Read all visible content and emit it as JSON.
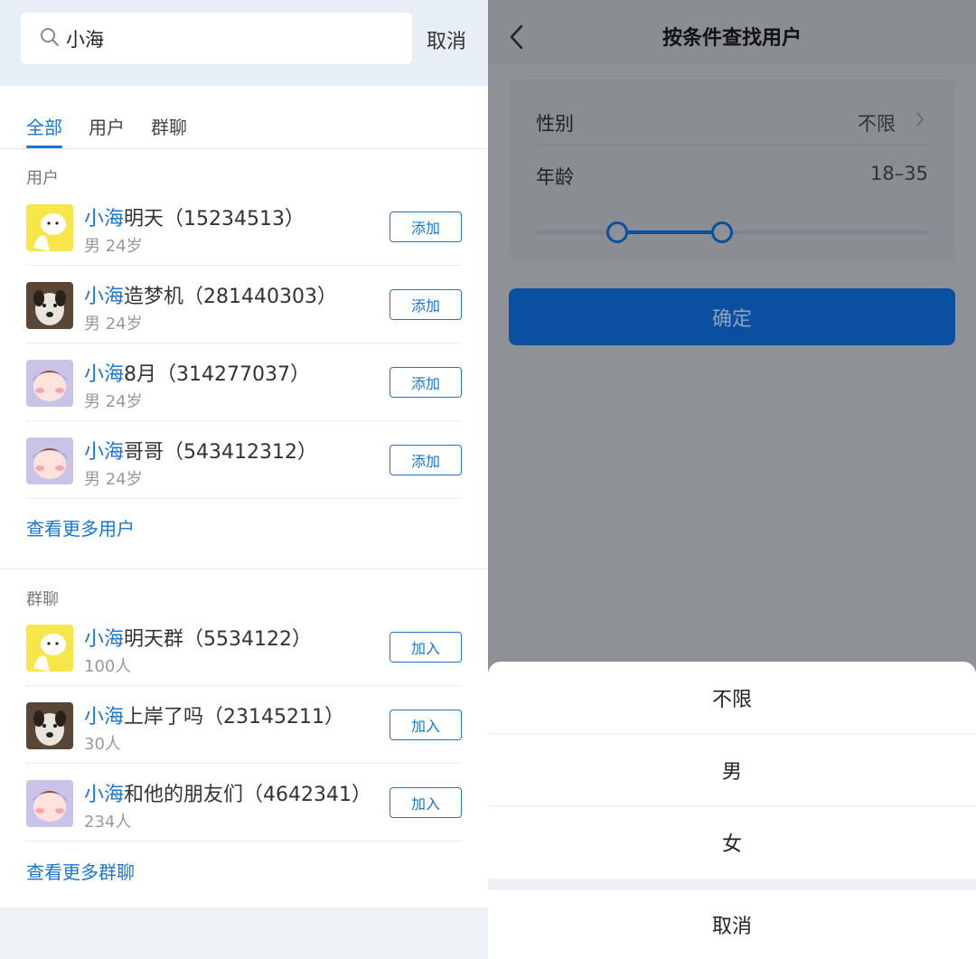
{
  "search": {
    "query": "小海",
    "cancel_label": "取消"
  },
  "tabs": [
    {
      "label": "全部",
      "active": true
    },
    {
      "label": "用户",
      "active": false
    },
    {
      "label": "群聊",
      "active": false
    }
  ],
  "users_section": {
    "label": "用户",
    "items": [
      {
        "highlight": "小海",
        "rest": "明天（15234513）",
        "sub": "男 24岁",
        "action": "添加",
        "avatar": "cartoon-yellow-avatar"
      },
      {
        "highlight": "小海",
        "rest": "造梦机（281440303）",
        "sub": "男 24岁",
        "action": "添加",
        "avatar": "dog-photo-avatar"
      },
      {
        "highlight": "小海",
        "rest": "8月（314277037）",
        "sub": "男 24岁",
        "action": "添加",
        "avatar": "cartoon-girl-avatar"
      },
      {
        "highlight": "小海",
        "rest": "哥哥（543412312）",
        "sub": "男 24岁",
        "action": "添加",
        "avatar": "cartoon-girl-avatar"
      }
    ],
    "more_label": "查看更多用户"
  },
  "groups_section": {
    "label": "群聊",
    "items": [
      {
        "highlight": "小海",
        "rest": "明天群（5534122）",
        "sub": "100人",
        "action": "加入",
        "avatar": "cartoon-yellow-avatar"
      },
      {
        "highlight": "小海",
        "rest": "上岸了吗（23145211）",
        "sub": "30人",
        "action": "加入",
        "avatar": "dog-photo-avatar"
      },
      {
        "highlight": "小海",
        "rest": "和他的朋友们（4642341）",
        "sub": "234人",
        "action": "加入",
        "avatar": "cartoon-girl-avatar"
      }
    ],
    "more_label": "查看更多群聊"
  },
  "filter_page": {
    "title": "按条件查找用户",
    "gender_label": "性别",
    "gender_value": "不限",
    "age_label": "年龄",
    "age_value": "18–35",
    "age_range": [
      18,
      35
    ],
    "confirm_label": "确定"
  },
  "action_sheet": {
    "options": [
      "不限",
      "男",
      "女"
    ],
    "cancel_label": "取消"
  },
  "colors": {
    "accent": "#1976d2",
    "overlay_primary": "#0a4fa0"
  }
}
